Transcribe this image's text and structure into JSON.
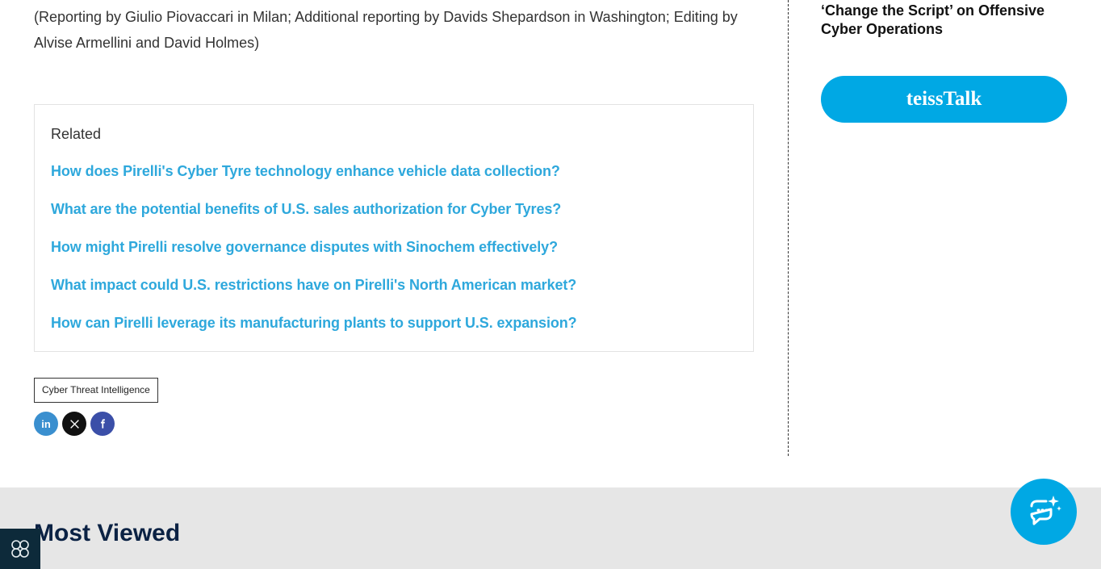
{
  "article": {
    "credit": "(Reporting by Giulio Piovaccari in Milan; Additional reporting by Davids Shepardson in Washington; Editing by Alvise Armellini and David Holmes)"
  },
  "related": {
    "heading": "Related",
    "items": [
      {
        "label": "How does Pirelli's Cyber Tyre technology enhance vehicle data collection?"
      },
      {
        "label": "What are the potential benefits of U.S. sales authorization for Cyber Tyres?"
      },
      {
        "label": "How might Pirelli resolve governance disputes with Sinochem effectively?"
      },
      {
        "label": "What impact could U.S. restrictions have on Pirelli's North American market?"
      },
      {
        "label": "How can Pirelli leverage its manufacturing plants to support U.S. expansion?"
      }
    ]
  },
  "tags": [
    "Cyber Threat Intelligence"
  ],
  "share": {
    "linkedin_label": "in",
    "colors": {
      "linkedin": "#3a8fcf",
      "x": "#111111",
      "facebook": "#3b4fa8"
    }
  },
  "sidebar": {
    "article_title": "‘Change the Script’ on Offensive Cyber Operations",
    "cta_label": "teissTalk"
  },
  "most_viewed": {
    "heading": "Most Viewed"
  },
  "icons": {
    "chat": "chat-sparkle-icon",
    "corner": "network-nodes-icon"
  }
}
